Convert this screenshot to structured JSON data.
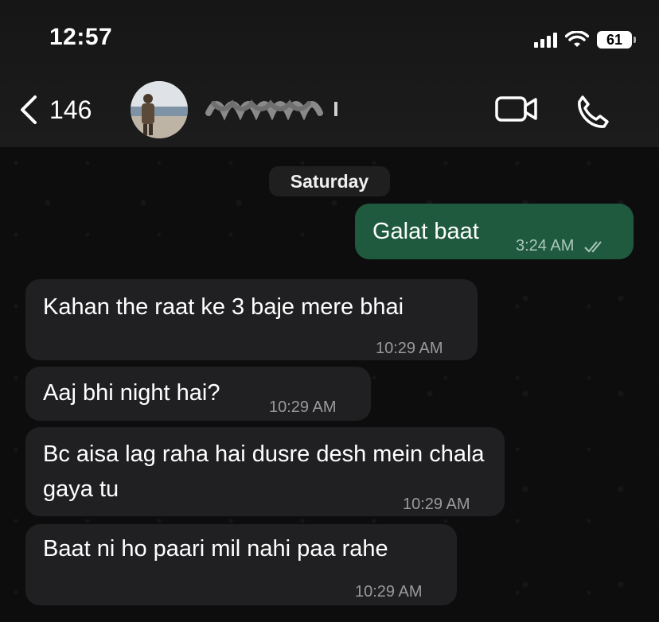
{
  "status_bar": {
    "time": "12:57",
    "battery": "61"
  },
  "header": {
    "back_count": "146"
  },
  "chat": {
    "day_label": "Saturday",
    "messages": [
      {
        "direction": "outgoing",
        "text": "Galat baat",
        "time": "3:24 AM",
        "status": "read"
      },
      {
        "direction": "incoming",
        "text": "Kahan the raat ke 3 baje mere bhai",
        "time": "10:29 AM"
      },
      {
        "direction": "incoming",
        "text": "Aaj bhi night hai?",
        "time": "10:29 AM"
      },
      {
        "direction": "incoming",
        "text": "Bc aisa lag raha hai dusre desh mein chala gaya tu",
        "time": "10:29 AM"
      },
      {
        "direction": "incoming",
        "text": "Baat ni ho paari mil nahi paa rahe",
        "time": "10:29 AM"
      }
    ]
  },
  "colors": {
    "outgoing_bubble": "#1f5a3f",
    "incoming_bubble": "#202022",
    "background": "#0d0d0d"
  }
}
